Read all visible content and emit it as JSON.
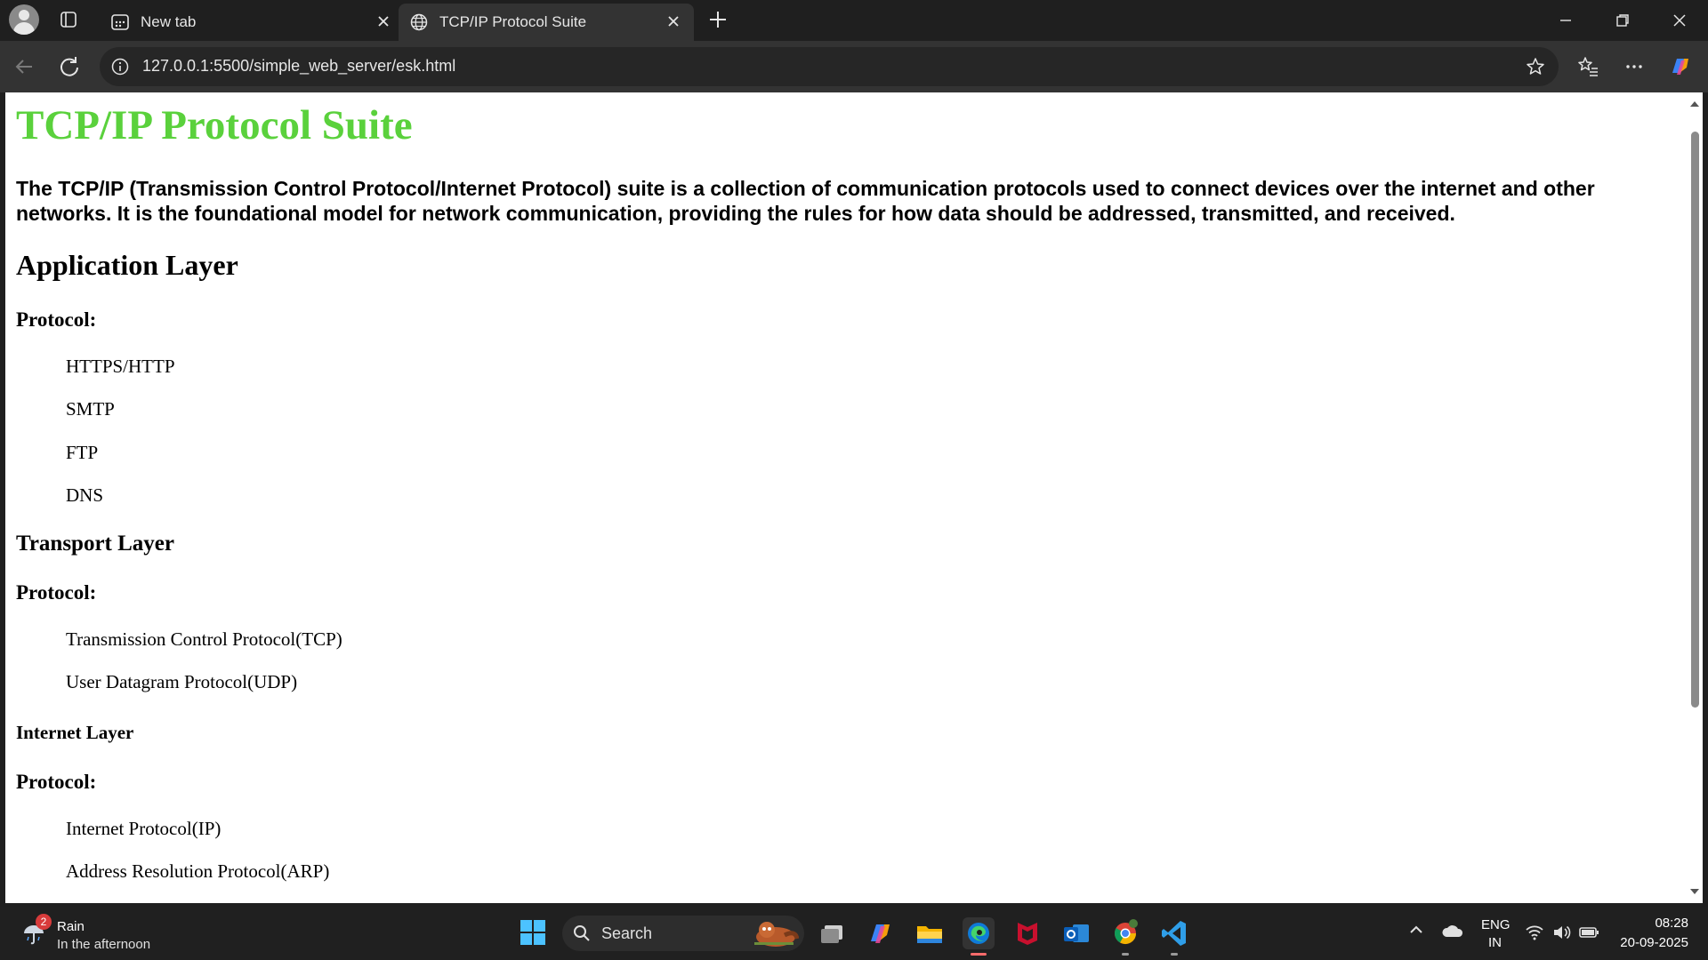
{
  "browser": {
    "tabs": [
      {
        "label": "New tab",
        "icon": "newtab-page-icon",
        "active": false
      },
      {
        "label": "TCP/IP Protocol Suite",
        "icon": "globe-icon",
        "active": true
      }
    ],
    "url": "127.0.0.1:5500/simple_web_server/esk.html"
  },
  "page": {
    "title": "TCP/IP Protocol Suite",
    "intro": "The TCP/IP (Transmission Control Protocol/Internet Protocol) suite is a collection of communication protocols used to connect devices over the internet and other networks. It is the foundational model for network communication, providing the rules for how data should be addressed, transmitted, and received.",
    "application_layer": {
      "heading": "Application Layer",
      "protocol_label": "Protocol:",
      "items": [
        "HTTPS/HTTP",
        "SMTP",
        "FTP",
        "DNS"
      ]
    },
    "transport_layer": {
      "heading": "Transport Layer",
      "protocol_label": "Protocol:",
      "items": [
        "Transmission Control Protocol(TCP)",
        "User Datagram Protocol(UDP)"
      ]
    },
    "internet_layer": {
      "heading": "Internet Layer",
      "protocol_label": "Protocol:",
      "items": [
        "Internet Protocol(IP)",
        "Address Resolution Protocol(ARP)"
      ]
    },
    "title_color": "#5ad13c"
  },
  "taskbar": {
    "weather": {
      "badge": "2",
      "condition": "Rain",
      "detail": "In the afternoon"
    },
    "search_placeholder": "Search",
    "language": {
      "line1": "ENG",
      "line2": "IN"
    },
    "time": "08:28",
    "date": "20-09-2025"
  }
}
